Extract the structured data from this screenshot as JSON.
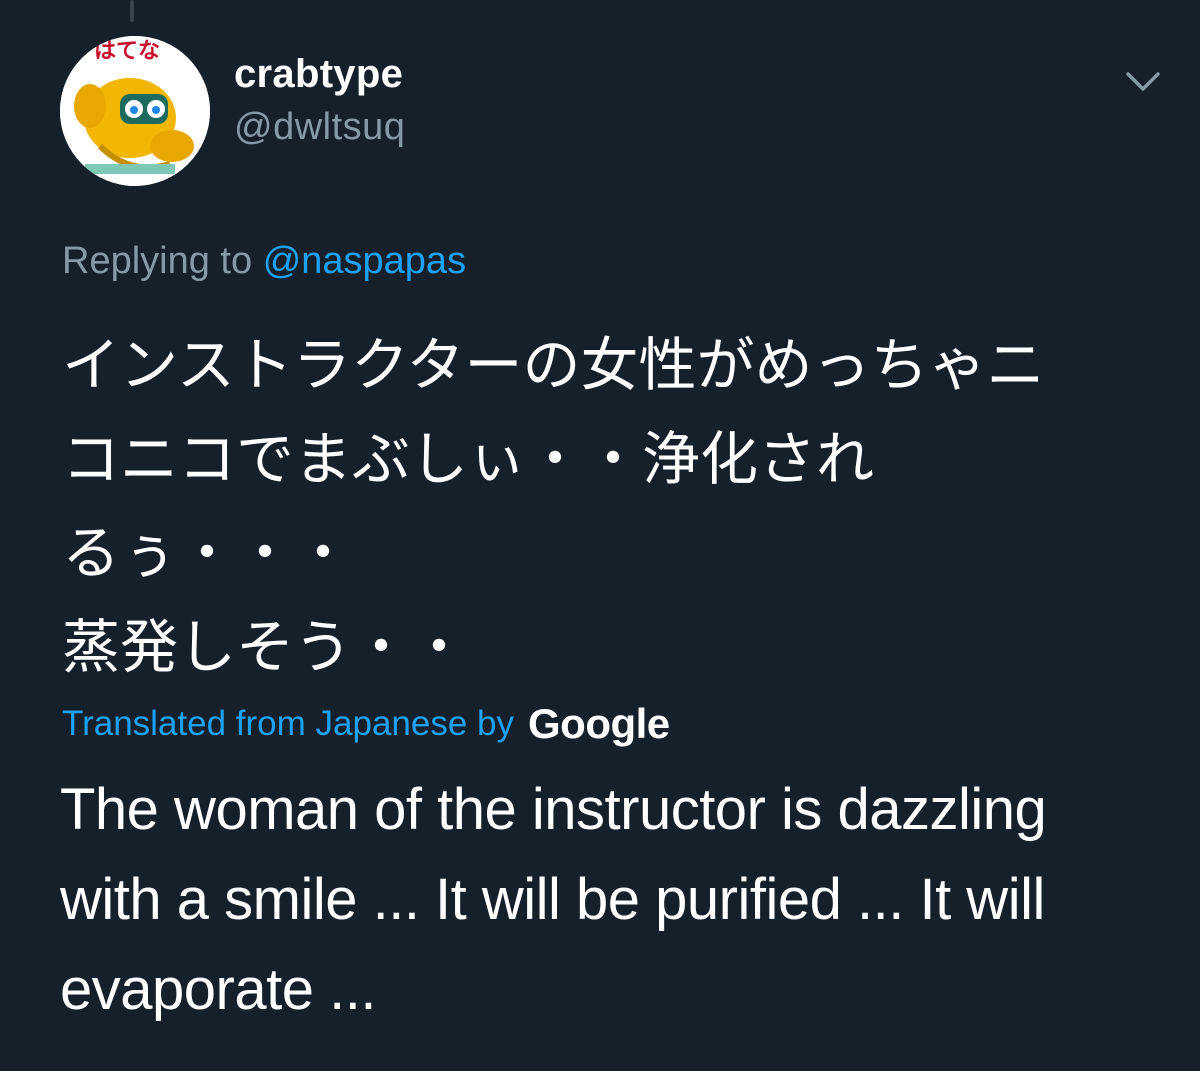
{
  "tweet": {
    "author": {
      "display_name": "crabtype",
      "handle": "@dwltsuq",
      "avatar_icon": "crab-mascot-avatar",
      "avatar_text": "はてな"
    },
    "menu_icon": "chevron-down-icon",
    "reply": {
      "prefix": "Replying to",
      "mention": "@naspapas"
    },
    "original_text_lines": [
      "インストラクターの女性がめっちゃニ",
      "コニコでまぶしぃ・・浄化され",
      "るぅ・・・",
      "蒸発しそう・・"
    ],
    "translation": {
      "label": "Translated from Japanese by",
      "provider": "Google",
      "text_lines": [
        "The woman of the instructor is dazzling",
        "with a smile ... It will be purified ... It will",
        "evaporate ..."
      ]
    }
  },
  "colors": {
    "background": "#15202b",
    "primary_text": "#ffffff",
    "secondary_text": "#8899a6",
    "accent": "#1da1f2"
  }
}
